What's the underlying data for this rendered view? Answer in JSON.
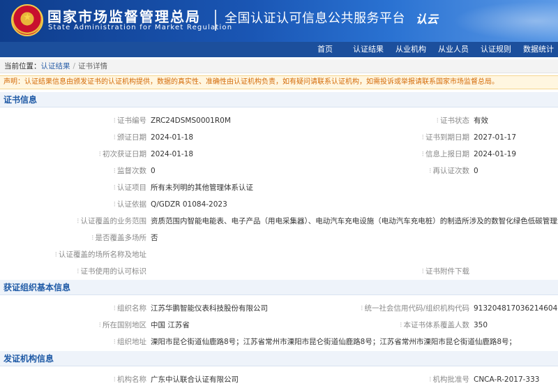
{
  "header": {
    "agency_zh": "国家市场监督管理总局",
    "agency_en": "State Administration for Market Regulation",
    "platform": "全国认证认可信息公共服务平台",
    "logo_mark": "认云"
  },
  "nav": {
    "items": [
      "首页",
      "认证结果",
      "从业机构",
      "从业人员",
      "认证规则",
      "数据统计"
    ]
  },
  "breadcrumb": {
    "here": "当前位置：",
    "level1": "认证结果",
    "separator": "/",
    "level2": "证书详情"
  },
  "notice": "声明：认证结果信息由颁发证书的认证机构提供，数据的真实性、准确性由认证机构负责，如有疑问请联系认证机构，如需投诉或举报请联系国家市场监督总局。",
  "cert_info": {
    "title": "证书信息",
    "rows": [
      {
        "left_label": "证书编号",
        "left_value": "ZRC24DSMS0001R0M",
        "right_label": "证书状态",
        "right_value": "有效"
      },
      {
        "left_label": "颁证日期",
        "left_value": "2024-01-18",
        "right_label": "证书到期日期",
        "right_value": "2027-01-17"
      },
      {
        "left_label": "初次获证日期",
        "left_value": "2024-01-18",
        "right_label": "信息上报日期",
        "right_value": "2024-01-19"
      },
      {
        "left_label": "监督次数",
        "left_value": "0",
        "right_label": "再认证次数",
        "right_value": "0"
      },
      {
        "left_label": "认证项目",
        "left_value": "所有未列明的其他管理体系认证"
      },
      {
        "left_label": "认证依据",
        "left_value": "Q/GDZR 01084-2023"
      },
      {
        "left_label": "认证覆盖的业务范围",
        "left_value": "资质范围内智能电能表、电子产品（用电采集器）、电动汽车充电设施（电动汽车充电桩）的制造所涉及的数智化绿色低碳管理活动"
      },
      {
        "left_label": "是否覆盖多场所",
        "left_value": "否"
      },
      {
        "left_label": "认证覆盖的场所名称及地址",
        "left_value": ""
      },
      {
        "left_label": "证书使用的认可标识",
        "left_value": "",
        "right_label": "证书附件下载",
        "right_value": ""
      }
    ]
  },
  "org_info": {
    "title": "获证组织基本信息",
    "rows": [
      {
        "left_label": "组织名称",
        "left_value": "江苏华鹏智能仪表科技股份有限公司",
        "right_label": "统一社会信用代码/组织机构代码",
        "right_value": "91320481703621460​4"
      },
      {
        "left_label": "所在国别地区",
        "left_value": "中国 江苏省",
        "right_label": "本证书体系覆盖人数",
        "right_value": "350"
      },
      {
        "left_label": "组织地址",
        "left_value": "溧阳市昆仑街道仙鹿路8号；江苏省常州市溧阳市昆仑街道仙鹿路8号；江苏省常州市溧阳市昆仑街道仙鹿路8号；"
      }
    ]
  },
  "issuer_info": {
    "title": "发证机构信息",
    "rows": [
      {
        "left_label": "机构名称",
        "left_value": "广东中认联合认证有限公司",
        "right_label": "机构批准号",
        "right_value": "CNCA-R-2017-333"
      }
    ]
  }
}
